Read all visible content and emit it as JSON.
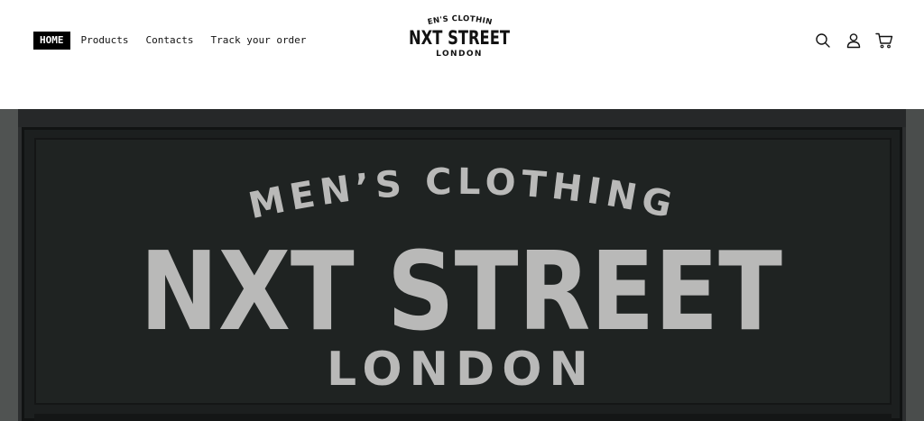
{
  "nav": {
    "items": [
      {
        "label": "HOME",
        "active": true
      },
      {
        "label": "Products",
        "active": false
      },
      {
        "label": "Contacts",
        "active": false
      },
      {
        "label": "Track your order",
        "active": false
      }
    ]
  },
  "logo": {
    "top": "MEN'S CLOTHING",
    "main": "NXT STREET",
    "bottom": "LONDON"
  },
  "header_icons": [
    "search-icon",
    "account-icon",
    "cart-icon"
  ],
  "hero": {
    "top": "MEN’S CLOTHING",
    "main": "NXT STREET",
    "bottom": "LONDON"
  },
  "colors": {
    "nav_active_bg": "#000000",
    "hero_board": "#1f2322",
    "hero_text": "#b9b9b8"
  }
}
